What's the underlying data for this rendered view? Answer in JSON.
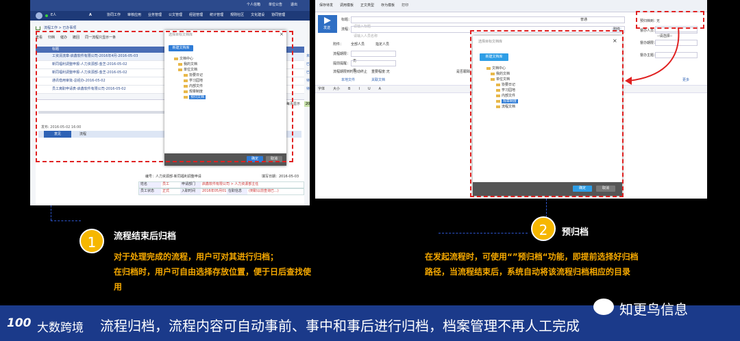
{
  "left_app": {
    "topbar_links": [
      "个人信箱",
      "单位公告",
      "退出"
    ],
    "user": "E人",
    "nav": [
      "协同工作",
      "审核应用",
      "业务管理",
      "公文管理",
      "经验管理",
      "统计管理",
      "规则社区",
      "文化建设",
      "协同管理"
    ],
    "breadcrumb": "流程工作 > 已办事项",
    "toolbar": [
      "查看",
      "归档",
      "催办",
      "撤回",
      "同一流程只显示一条"
    ],
    "table_header": [
      "标题",
      "状态"
    ],
    "rows": [
      {
        "title": "工资清流章-启鑫软件有限公司-2016年4月-2016-05-03",
        "status": "未办"
      },
      {
        "title": "新同福利调整申报-人力资源部-金芝-2016-05-02",
        "status": "已办"
      },
      {
        "title": "新同福利调整申报-人力资源部-金芝-2016-05-02",
        "status": "已办"
      },
      {
        "title": "通讯借用审批-总经办-2016-05-02",
        "status": "待批复"
      },
      {
        "title": "员工离职申请表-启鑫软件有限公司-2016-05-02",
        "status": "待批复"
      }
    ],
    "detail_date": "发布: 2016-05-02 16:00",
    "tabs": [
      "意见",
      "流程"
    ],
    "pagination": "每页显示",
    "pagination_btn": "20",
    "form": {
      "rows": [
        [
          "姓名",
          "员工",
          "申请部门",
          "启鑫软件有限公司 > 人力资源部主任"
        ],
        [
          "员工状态",
          "正式",
          "入职时间",
          "2016年05月01日",
          "在职信息",
          "(到职以前查询已...)"
        ]
      ],
      "header": "编号：人力资源部-新同福利调整申请",
      "date_label": "填写日期：2016-05-03"
    }
  },
  "dialog_left": {
    "title": "选择目标文档库",
    "new_button": "新建文档库",
    "tree": [
      "文档中心",
      "我的文档",
      "单位文档",
      "协要日记",
      "学习园地",
      "内部文件",
      "规章制度",
      "预归文档"
    ],
    "ok": "确定",
    "cancel": "取消"
  },
  "right_app": {
    "toolbar": [
      "保存待发",
      "调用模板",
      "正文类型",
      "存为模板",
      "打印"
    ],
    "send": "发送",
    "fields": {
      "title_label": "标题：",
      "title_placeholder": "请输入标题",
      "urgency": "普通",
      "flow_label": "流程：",
      "flow_placeholder": "请输入人员名称",
      "attach": "附件",
      "archive_label": "预归档到：",
      "archive_select": "--请选择--",
      "archive_value": "无"
    },
    "labels": [
      "附件：",
      "流程期限：",
      "提前提醒：",
      "流程期限到时自动终止",
      "重要程度：",
      "是否跟踪",
      "全部人员",
      "指定人员"
    ],
    "values": [
      "无",
      "无",
      "无"
    ],
    "right_labels": [
      "预归档到：",
      "督办人员：",
      "督办期限：",
      "督办主题："
    ],
    "right_link": "更多",
    "editor_tools": [
      "字体",
      "大小",
      "B",
      "I",
      "U",
      "A"
    ],
    "upload": [
      "本地文件",
      "关联文档"
    ]
  },
  "dialog_right": {
    "title": "选择目标文档库",
    "new_button": "新建文档库",
    "tree": [
      "文档中心",
      "我的文档",
      "单位文档",
      "协要日记",
      "学习园地",
      "内部文件",
      "规章制度",
      "流程文档"
    ],
    "ok": "确定",
    "cancel": "取消"
  },
  "annotations": [
    {
      "number": "1",
      "title": "流程结束后归档",
      "lines": [
        "对于处理完成的流程，用户可对其进行归档；",
        "在归档时，用户可自由选择存放位置，便于日后查找使",
        "用"
      ]
    },
    {
      "number": "2",
      "title": "预归档",
      "lines": [
        "在发起流程时，可使用“”预归档“功能，即提前选择好归档",
        "路径，当流程结束后，系统自动将该流程归档相应的目录"
      ]
    }
  ],
  "bottom_bar": {
    "logo_text": "大数跨境",
    "logo_mark": "100",
    "text": "流程归档，流程内容可自动事前、事中和事后进行归档，档案管理不再人工完成",
    "wechat_name": "知更鸟信息"
  },
  "colors": {
    "accent_blue": "#1f3c8a",
    "orange": "#f5a800",
    "red_dash": "#e02020",
    "dialog_btn": "#2e7bd6"
  }
}
